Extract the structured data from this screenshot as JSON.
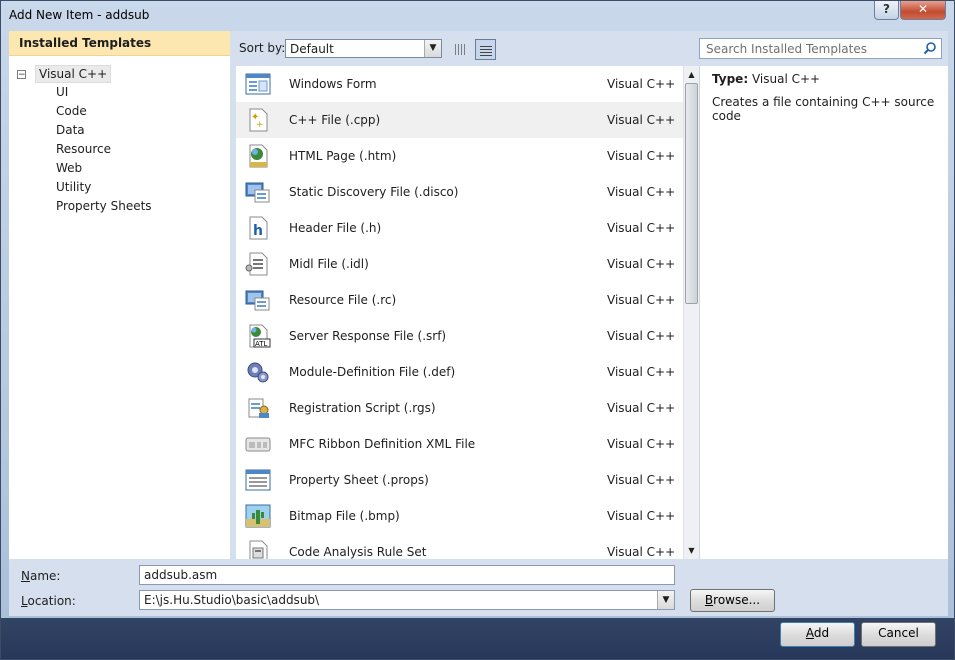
{
  "window": {
    "title": "Add New Item - addsub",
    "help_label": "?",
    "close_label": "✕"
  },
  "left": {
    "header": "Installed Templates",
    "root": {
      "label": "Visual C++",
      "expander": "−"
    },
    "children": [
      "UI",
      "Code",
      "Data",
      "Resource",
      "Web",
      "Utility",
      "Property Sheets"
    ]
  },
  "toolbar": {
    "sort_label": "Sort by:",
    "sort_value": "Default",
    "search_placeholder": "Search Installed Templates"
  },
  "templates": [
    {
      "name": "Windows Form",
      "lang": "Visual C++",
      "icon": "windows-form-icon",
      "selected": false
    },
    {
      "name": "C++ File (.cpp)",
      "lang": "Visual C++",
      "icon": "cpp-file-icon",
      "selected": true
    },
    {
      "name": "HTML Page (.htm)",
      "lang": "Visual C++",
      "icon": "html-page-icon",
      "selected": false
    },
    {
      "name": "Static Discovery File (.disco)",
      "lang": "Visual C++",
      "icon": "discovery-file-icon",
      "selected": false
    },
    {
      "name": "Header File (.h)",
      "lang": "Visual C++",
      "icon": "header-file-icon",
      "selected": false
    },
    {
      "name": "Midl File (.idl)",
      "lang": "Visual C++",
      "icon": "midl-file-icon",
      "selected": false
    },
    {
      "name": "Resource File (.rc)",
      "lang": "Visual C++",
      "icon": "resource-file-icon",
      "selected": false
    },
    {
      "name": "Server Response File (.srf)",
      "lang": "Visual C++",
      "icon": "atl-server-file-icon",
      "selected": false
    },
    {
      "name": "Module-Definition File (.def)",
      "lang": "Visual C++",
      "icon": "module-definition-icon",
      "selected": false
    },
    {
      "name": "Registration Script (.rgs)",
      "lang": "Visual C++",
      "icon": "registration-script-icon",
      "selected": false
    },
    {
      "name": "MFC Ribbon Definition XML File",
      "lang": "Visual C++",
      "icon": "ribbon-xml-icon",
      "selected": false
    },
    {
      "name": "Property Sheet (.props)",
      "lang": "Visual C++",
      "icon": "property-sheet-icon",
      "selected": false
    },
    {
      "name": "Bitmap File (.bmp)",
      "lang": "Visual C++",
      "icon": "bitmap-file-icon",
      "selected": false
    },
    {
      "name": "Code Analysis Rule Set",
      "lang": "Visual C++",
      "icon": "rule-set-icon",
      "selected": false
    }
  ],
  "details": {
    "type_label": "Type:",
    "type_value": "Visual C++",
    "description": "Creates a file containing C++ source code"
  },
  "form": {
    "name_label_access": "N",
    "name_label_rest": "ame:",
    "name_value": "addsub.asm",
    "location_label_access": "L",
    "location_label_rest": "ocation:",
    "location_value": "E:\\js.Hu.Studio\\basic\\addsub\\",
    "browse_access": "B",
    "browse_rest": "rowse..."
  },
  "footer": {
    "add_access": "A",
    "add_rest": "dd",
    "cancel_label": "Cancel"
  },
  "colors": {
    "header_bg": "#fde7b0",
    "selected_row": "#f0f0f0",
    "accent_blue": "#1f5fa8"
  }
}
